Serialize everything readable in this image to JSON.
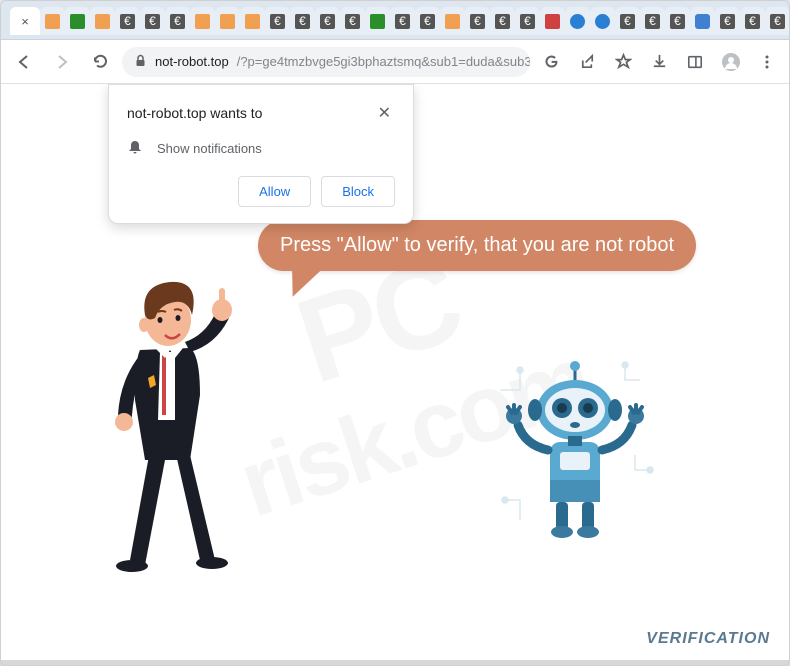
{
  "window": {
    "tabs_count": 33,
    "new_tab_glyph": "+"
  },
  "toolbar": {
    "url_domain": "not-robot.top",
    "url_path": "/?p=ge4tmzbvge5gi3bphaztsmq&sub1=duda&sub3=30644..."
  },
  "notification": {
    "site_text": "not-robot.top wants to",
    "permission_text": "Show notifications",
    "allow_label": "Allow",
    "block_label": "Block"
  },
  "page": {
    "speech_text": "Press \"Allow\" to verify, that you are not robot",
    "verification_label": "VERIFICATION",
    "watermark_line1": "PC",
    "watermark_line2": "risk.com"
  }
}
